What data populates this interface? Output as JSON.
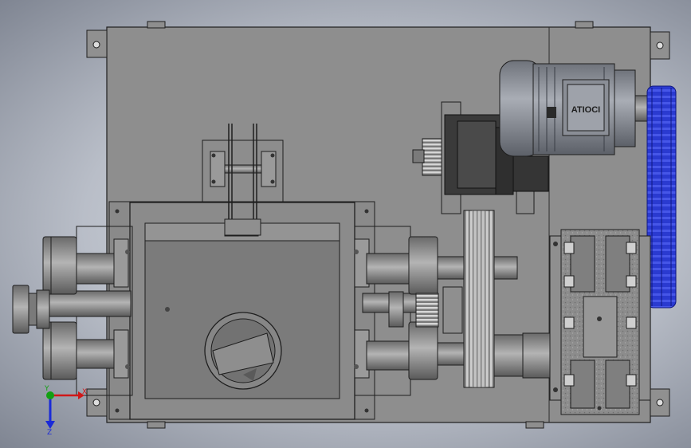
{
  "viewport": {
    "background_center": "#dfe2e8",
    "background_edge": "#7f8592"
  },
  "model": {
    "frame_color": "#8e8e8e",
    "part_color": "#959595",
    "dark_part_color": "#3a3a3a",
    "belt_color": "#2a3ad0",
    "edge_color": "#1e1e1e"
  },
  "motor": {
    "nameplate_text": "ATIOCI",
    "body_color": "#8f939b"
  },
  "triad": {
    "x_label": "X",
    "y_label": "Y",
    "z_label": "Z",
    "x_color": "#d01818",
    "y_color": "#12a012",
    "z_color": "#1a2ad8"
  }
}
